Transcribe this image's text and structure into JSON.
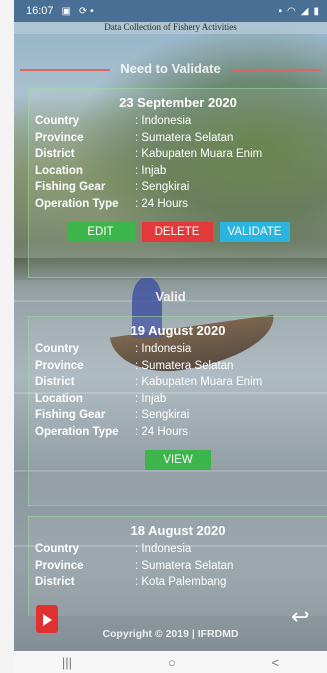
{
  "status_bar": {
    "time": "16:07",
    "icons_left": [
      "gallery-icon",
      "sync-icon"
    ],
    "icons_right": [
      "notification-icon",
      "wifi-icon",
      "signal-icon",
      "battery-icon"
    ]
  },
  "app_subtitle": "Data Collection of Fishery Activities",
  "sections": {
    "need_to_validate": "Need to Validate",
    "valid": "Valid"
  },
  "labels": {
    "country": "Country",
    "province": "Province",
    "district": "District",
    "location": "Location",
    "fishing_gear": "Fishing Gear",
    "operation_type": "Operation Type"
  },
  "cards": [
    {
      "date": "23 September 2020",
      "country": "Indonesia",
      "province": "Sumatera Selatan",
      "district": "Kabupaten Muara Enim",
      "location": "Injab",
      "fishing_gear": "Sengkirai",
      "operation_type": "24 Hours",
      "actions": {
        "edit": "EDIT",
        "delete": "DELETE",
        "validate": "VALIDATE"
      }
    },
    {
      "date": "19 August 2020",
      "country": "Indonesia",
      "province": "Sumatera Selatan",
      "district": "Kabupaten Muara Enim",
      "location": "Injab",
      "fishing_gear": "Sengkirai",
      "operation_type": "24 Hours",
      "actions": {
        "view": "VIEW"
      }
    },
    {
      "date": "18 August 2020",
      "country": "Indonesia",
      "province": "Sumatera Selatan",
      "district": "Kota Palembang"
    }
  ],
  "footer": {
    "copyright": "Copyright © 2019 | IFRDMD"
  },
  "navbar": {
    "recents": "|||",
    "home": "○",
    "back": "<"
  },
  "colors": {
    "edit": "#3cb54a",
    "delete": "#e23a3a",
    "validate": "#2ab4e0",
    "status_bar": "#4a6f95"
  }
}
